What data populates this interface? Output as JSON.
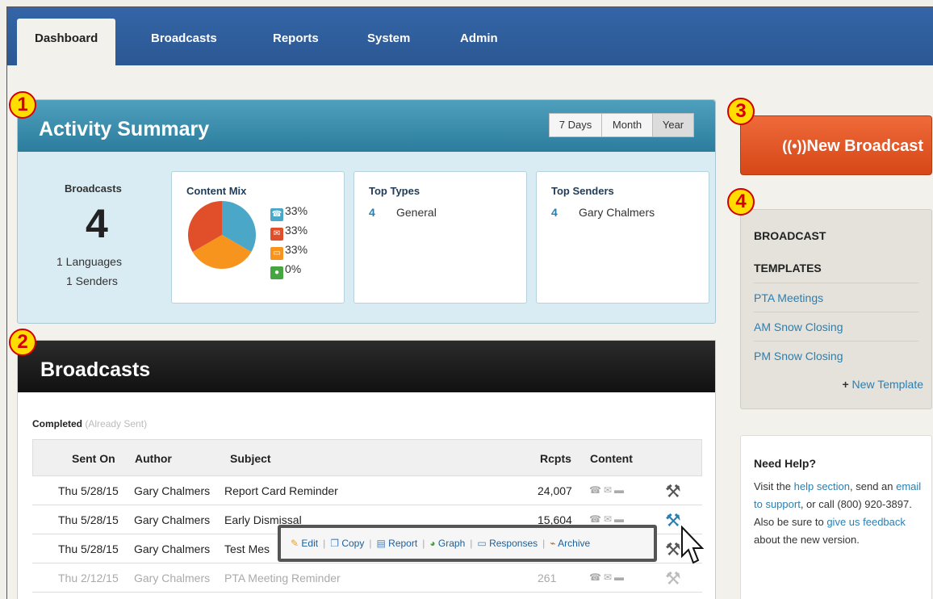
{
  "nav": {
    "tabs": [
      "Dashboard",
      "Broadcasts",
      "Reports",
      "System",
      "Admin"
    ]
  },
  "markers": [
    "1",
    "2",
    "3",
    "4"
  ],
  "activity": {
    "title": "Activity Summary",
    "periods": [
      "7 Days",
      "Month",
      "Year"
    ],
    "selected_period": "Year",
    "broadcasts_label": "Broadcasts",
    "broadcasts_count": "4",
    "languages": "1 Languages",
    "senders": "1 Senders",
    "content_mix": {
      "title": "Content Mix",
      "items": [
        {
          "icon": "phone-icon",
          "value": "33%",
          "color": "#4aa7c8"
        },
        {
          "icon": "email-icon",
          "value": "33%",
          "color": "#e04f2a"
        },
        {
          "icon": "sms-icon",
          "value": "33%",
          "color": "#f7941d"
        },
        {
          "icon": "user-icon",
          "value": "0%",
          "color": "#45a540"
        }
      ]
    },
    "top_types": {
      "title": "Top Types",
      "count": "4",
      "name": "General"
    },
    "top_senders": {
      "title": "Top Senders",
      "count": "4",
      "name": "Gary Chalmers"
    }
  },
  "broadcasts": {
    "title": "Broadcasts",
    "completed": "Completed",
    "completed_note": "(Already Sent)",
    "columns": [
      "Sent On",
      "Author",
      "Subject",
      "Rcpts",
      "Content"
    ],
    "rows": [
      {
        "sent": "Thu 5/28/15",
        "author": "Gary Chalmers",
        "subject": "Report Card Reminder",
        "rcpts": "24,007"
      },
      {
        "sent": "Thu 5/28/15",
        "author": "Gary Chalmers",
        "subject": "Early Dismissal",
        "rcpts": "15,604"
      },
      {
        "sent": "Thu 5/28/15",
        "author": "Gary Chalmers",
        "subject": "Test Mes",
        "rcpts": ""
      },
      {
        "sent": "Thu 2/12/15",
        "author": "Gary Chalmers",
        "subject": "PTA Meeting Reminder",
        "rcpts": "261"
      }
    ],
    "actions": [
      "Edit",
      "Copy",
      "Report",
      "Graph",
      "Responses",
      "Archive"
    ]
  },
  "sidebar": {
    "new_broadcast": "New Broadcast",
    "templates_heading_1": "BROADCAST",
    "templates_heading_2": "TEMPLATES",
    "templates": [
      "PTA Meetings",
      "AM Snow Closing",
      "PM Snow Closing"
    ],
    "new_template": "New Template",
    "help": {
      "title": "Need Help?",
      "t1": "Visit the ",
      "l1": "help section",
      "t2": ", send an ",
      "l2": "email to support",
      "t3": ", or call (800) 920-3897. Also be sure to ",
      "l3": "give us feedback",
      "t4": " about the new version."
    }
  }
}
